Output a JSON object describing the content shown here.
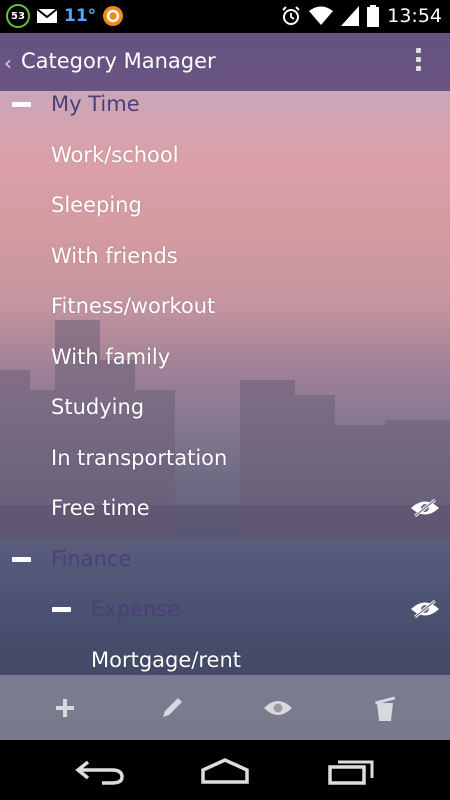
{
  "status_bar": {
    "notification_count": "53",
    "temperature": "11°",
    "time": "13:54",
    "icons": [
      "notification-badge-icon",
      "gmail-icon",
      "weather-temp",
      "app-orange-icon",
      "alarm-icon",
      "wifi-icon",
      "signal-icon",
      "battery-icon"
    ]
  },
  "action_bar": {
    "title": "Category Manager",
    "back_icon": "chevron-left-icon",
    "overflow_icon": "overflow-menu-icon"
  },
  "categories": [
    {
      "label": "My Time",
      "type": "category",
      "level": 0,
      "collapsed": false
    },
    {
      "label": "Work/school",
      "type": "item",
      "level": 0
    },
    {
      "label": "Sleeping",
      "type": "item",
      "level": 0
    },
    {
      "label": "With friends",
      "type": "item",
      "level": 0
    },
    {
      "label": "Fitness/workout",
      "type": "item",
      "level": 0
    },
    {
      "label": "With family",
      "type": "item",
      "level": 0
    },
    {
      "label": "Studying",
      "type": "item",
      "level": 0
    },
    {
      "label": "In transportation",
      "type": "item",
      "level": 0
    },
    {
      "label": "Free time",
      "type": "item",
      "level": 0,
      "hidden": true
    },
    {
      "label": "Finance",
      "type": "category",
      "level": 0,
      "collapsed": false
    },
    {
      "label": "Expense",
      "type": "category",
      "level": 1,
      "collapsed": false,
      "hidden": true
    },
    {
      "label": "Mortgage/rent",
      "type": "item",
      "level": 1
    }
  ],
  "bottom_bar": {
    "buttons": [
      "add-icon",
      "edit-pencil-icon",
      "visibility-eye-icon",
      "delete-trash-icon"
    ]
  },
  "nav_bar": {
    "buttons": [
      "back-nav-icon",
      "home-nav-icon",
      "recents-nav-icon"
    ]
  },
  "colors": {
    "action_bar": "#544276",
    "category_text": "#4a3f79",
    "item_text": "#ffffff",
    "temperature": "#4fa8ff"
  }
}
